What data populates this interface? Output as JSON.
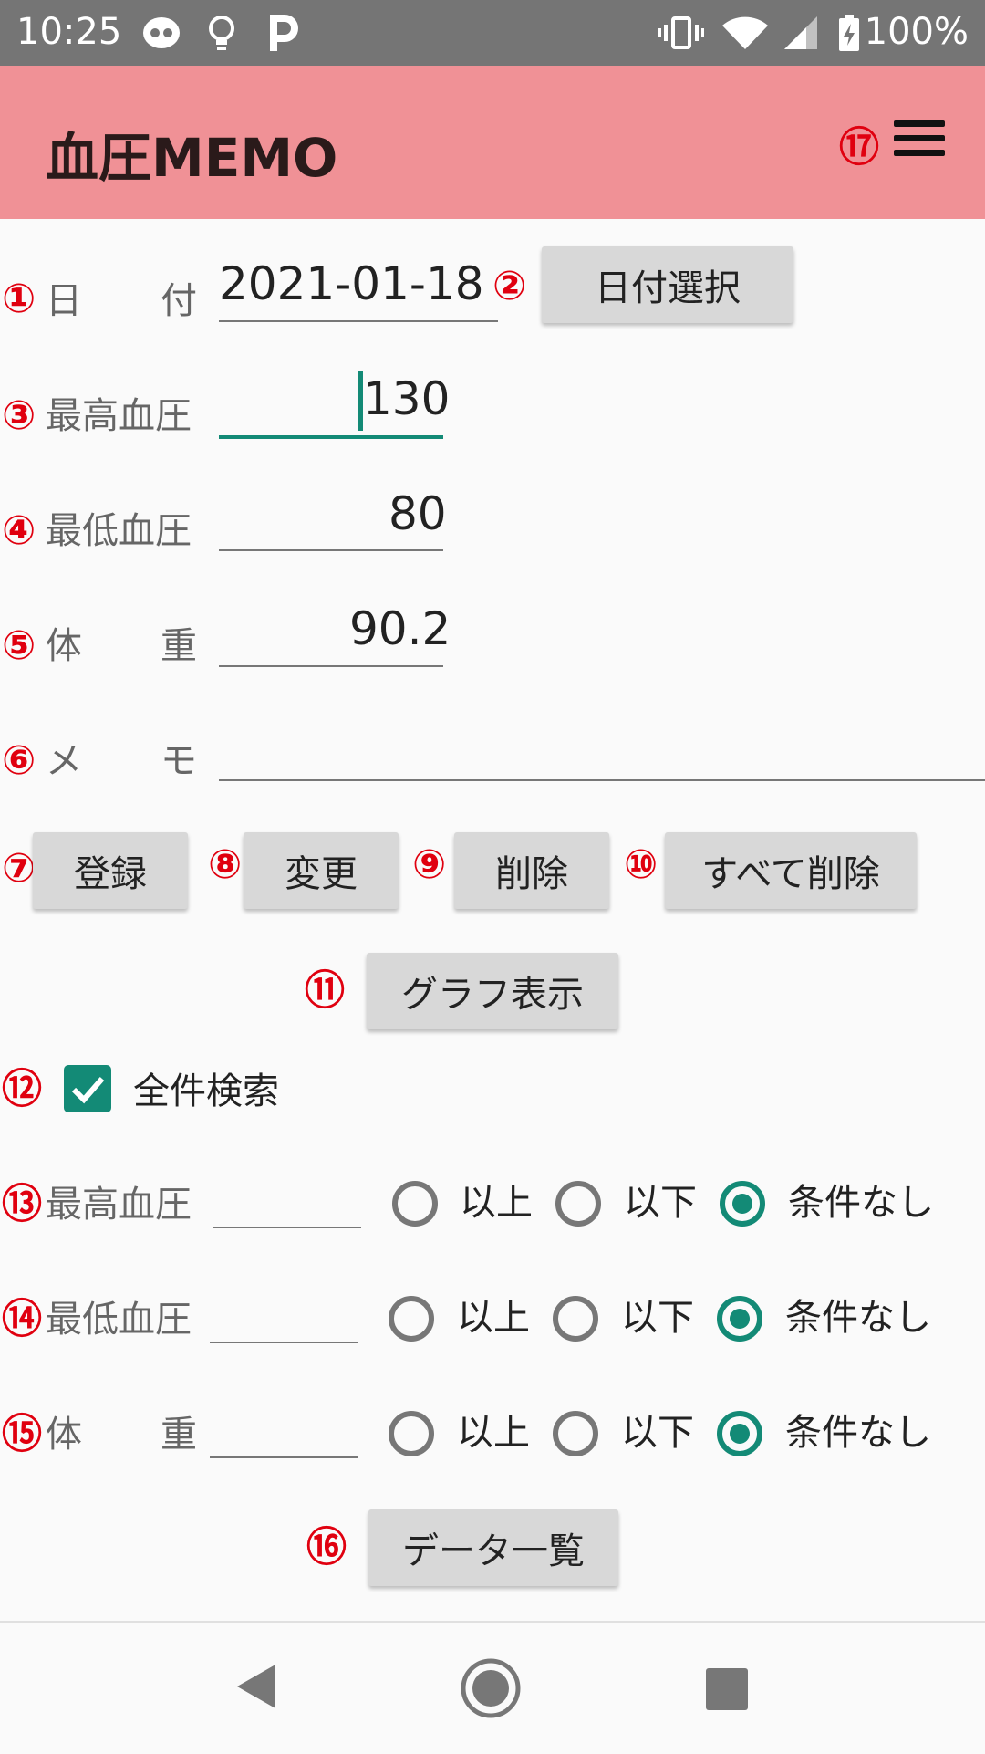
{
  "status_bar": {
    "time": "10:25",
    "icons": [
      "messenger-icon",
      "lightbulb-icon",
      "parking-icon",
      "vibrate-icon",
      "wifi-icon",
      "signal-icon",
      "battery-charging-icon"
    ],
    "battery": "100%"
  },
  "app_bar": {
    "title": "血圧MEMO",
    "menu_marker": "⑰"
  },
  "form": {
    "date": {
      "marker": "①",
      "label_a": "日",
      "label_b": "付",
      "value": "2021-01-18"
    },
    "date_button": {
      "marker": "②",
      "label": "日付選択"
    },
    "systolic": {
      "marker": "③",
      "label": "最高血圧",
      "value": "130"
    },
    "diastolic": {
      "marker": "④",
      "label": "最低血圧",
      "value": "80"
    },
    "weight": {
      "marker": "⑤",
      "label_a": "体",
      "label_b": "重",
      "value": "90.2"
    },
    "memo": {
      "marker": "⑥",
      "label_a": "メ",
      "label_b": "モ",
      "value": ""
    }
  },
  "actions": {
    "register": {
      "marker": "⑦",
      "label": "登録"
    },
    "update": {
      "marker": "⑧",
      "label": "変更"
    },
    "delete": {
      "marker": "⑨",
      "label": "削除"
    },
    "delete_all": {
      "marker": "⑩",
      "label": "すべて削除"
    },
    "graph": {
      "marker": "⑪",
      "label": "グラフ表示"
    }
  },
  "search": {
    "all": {
      "marker": "⑫",
      "label": "全件検索",
      "checked": true
    },
    "systolic": {
      "marker": "⑬",
      "label": "最高血圧",
      "value": "",
      "selected": "none"
    },
    "diastolic": {
      "marker": "⑭",
      "label": "最低血圧",
      "value": "",
      "selected": "none"
    },
    "weight": {
      "marker": "⑮",
      "label_a": "体",
      "label_b": "重",
      "value": "",
      "selected": "none"
    },
    "options": {
      "above": "以上",
      "below": "以下",
      "none": "条件なし"
    }
  },
  "list_button": {
    "marker": "⑯",
    "label": "データ一覧"
  },
  "colors": {
    "app_bar": "#f09196",
    "accent": "#138a76",
    "marker": "#e0000f",
    "button": "#d8d8d8"
  }
}
